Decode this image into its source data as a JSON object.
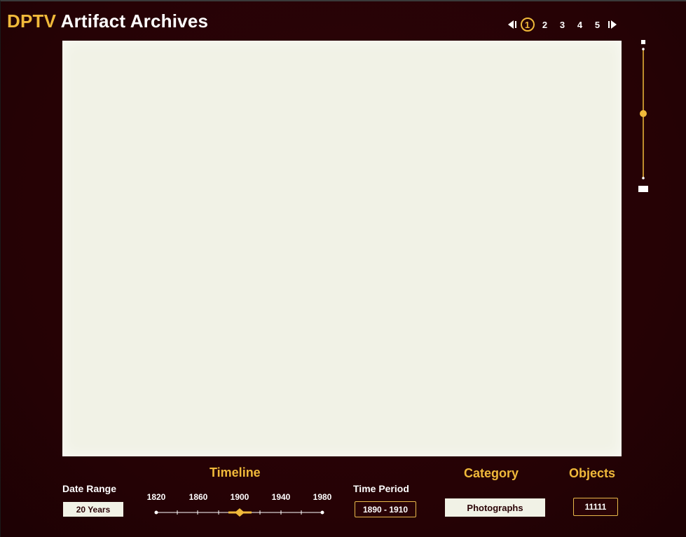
{
  "header": {
    "brand": "DPTV",
    "title": "Artifact Archives"
  },
  "pager": {
    "pages": [
      "1",
      "2",
      "3",
      "4",
      "5"
    ],
    "active_page": "1",
    "prev_icon": "prev-arrow-icon",
    "next_icon": "next-arrow-icon"
  },
  "zoom": {
    "level_fraction": 0.5
  },
  "footer": {
    "date_range": {
      "label": "Date Range",
      "value": "20 Years"
    },
    "timeline": {
      "title": "Timeline",
      "ticks": [
        "1820",
        "1860",
        "1900",
        "1940",
        "1980"
      ],
      "selected": "1900"
    },
    "time_period": {
      "label": "Time Period",
      "value": "1890 - 1910"
    },
    "category": {
      "title": "Category",
      "value": "Photographs"
    },
    "objects": {
      "title": "Objects",
      "value": "11111"
    }
  },
  "colors": {
    "background": "#2a0306",
    "accent": "#f0b93a",
    "viewer": "#f1f2e6",
    "text": "#ffffff"
  }
}
